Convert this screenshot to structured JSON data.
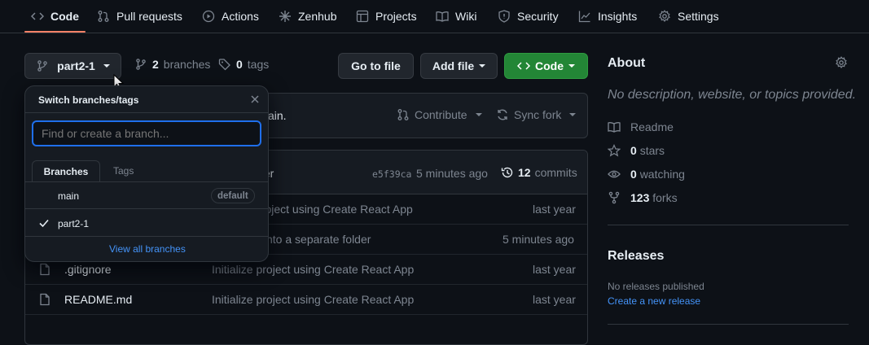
{
  "nav": {
    "tabs": [
      {
        "label": "Code",
        "icon": "code-icon"
      },
      {
        "label": "Pull requests",
        "icon": "pull-request-icon"
      },
      {
        "label": "Actions",
        "icon": "play-icon"
      },
      {
        "label": "Zenhub",
        "icon": "zenhub-icon"
      },
      {
        "label": "Projects",
        "icon": "table-icon"
      },
      {
        "label": "Wiki",
        "icon": "book-icon"
      },
      {
        "label": "Security",
        "icon": "shield-icon"
      },
      {
        "label": "Insights",
        "icon": "graph-icon"
      },
      {
        "label": "Settings",
        "icon": "gear-icon"
      }
    ]
  },
  "repo_bar": {
    "branch_button": "part2-1",
    "branches_count": "2",
    "branches_label": "branches",
    "tags_count": "0",
    "tags_label": "tags",
    "go_to_file": "Go to file",
    "add_file": "Add file",
    "code_button": "Code"
  },
  "fork_bar": {
    "text_fragment": "ain.",
    "contribute": "Contribute",
    "sync_fork": "Sync fork"
  },
  "commit_header": {
    "message_fragment": "lder",
    "sha": "e5f39ca",
    "time": "5 minutes ago",
    "commits_count": "12",
    "commits_label": "commits"
  },
  "files": [
    {
      "name": "",
      "message": "project using Create React App",
      "time": "last year"
    },
    {
      "name": "",
      "message": "k into a separate folder",
      "time": "5 minutes ago"
    },
    {
      "name": ".gitignore",
      "message": "Initialize project using Create React App",
      "time": "last year"
    },
    {
      "name": "README.md",
      "message": "Initialize project using Create React App",
      "time": "last year"
    }
  ],
  "dropdown": {
    "title": "Switch branches/tags",
    "search_placeholder": "Find or create a branch...",
    "tabs": [
      "Branches",
      "Tags"
    ],
    "branches": [
      {
        "name": "main",
        "badge": "default",
        "selected": false
      },
      {
        "name": "part2-1",
        "badge": "",
        "selected": true
      }
    ],
    "view_all": "View all branches"
  },
  "about": {
    "title": "About",
    "description": "No description, website, or topics provided.",
    "readme": "Readme",
    "stars_count": "0",
    "stars_label": "stars",
    "watching_count": "0",
    "watching_label": "watching",
    "forks_count": "123",
    "forks_label": "forks"
  },
  "releases": {
    "title": "Releases",
    "none": "No releases published",
    "create_link": "Create a new release"
  },
  "colors": {
    "background": "#0d1117",
    "accent_underline": "#f78166",
    "green_button": "#238636",
    "link": "#4493f8",
    "focus_ring": "#1f6feb"
  }
}
